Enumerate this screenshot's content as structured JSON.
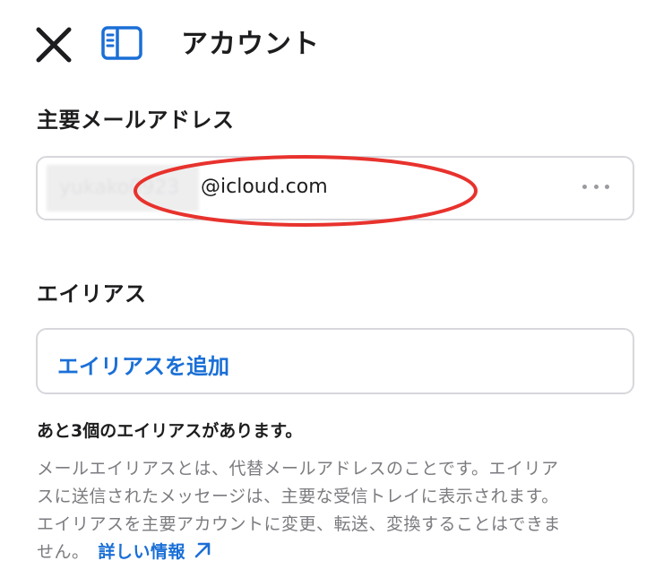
{
  "header": {
    "title": "アカウント",
    "close_icon": "close-icon",
    "sidebar_icon": "sidebar-toggle-icon"
  },
  "primary_email": {
    "section_label": "主要メールアドレス",
    "username_redacted": "yukako0923",
    "domain": "@icloud.com",
    "more_icon": "ellipsis-icon"
  },
  "aliases": {
    "section_label": "エイリアス",
    "add_button_label": "エイリアスを追加"
  },
  "info": {
    "remaining": "あと3個のエイリアスがあります。",
    "line1": "メールエイリアスとは、代替メールアドレスのことです。エイリア",
    "line2": "スに送信されたメッセージは、主要な受信トレイに表示されます。",
    "line3": "エイリアスを主要アカウントに変更、転送、変換することはできま",
    "line4": "せん。",
    "more_info_link": "詳しい情報",
    "more_info_icon": "arrow-up-right-icon"
  },
  "colors": {
    "accent": "#1a6fd6",
    "annotation_red": "#e8322d",
    "border": "#d7d7dc",
    "secondary_text": "#7b7b80"
  }
}
